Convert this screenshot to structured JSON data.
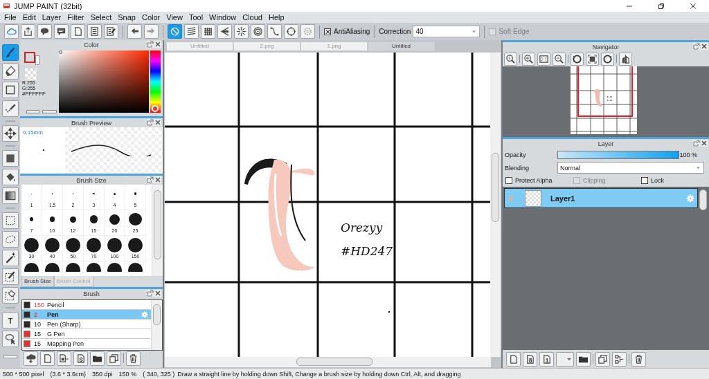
{
  "window": {
    "title": "JUMP PAINT (32bit)"
  },
  "menu": [
    "File",
    "Edit",
    "Layer",
    "Filter",
    "Select",
    "Snap",
    "Color",
    "View",
    "Tool",
    "Window",
    "Cloud",
    "Help"
  ],
  "toolbar": {
    "file_buttons": [
      {
        "kind": "cloud"
      },
      {
        "kind": "export"
      },
      {
        "kind": "balloon"
      },
      {
        "kind": "chat"
      },
      {
        "kind": "page"
      },
      {
        "kind": "list"
      },
      {
        "kind": "editlist"
      }
    ],
    "history_buttons": [
      {
        "kind": "undo"
      },
      {
        "kind": "redo"
      }
    ],
    "ruler_buttons": [
      {
        "kind": "noruler",
        "selected": true
      },
      {
        "kind": "parallel",
        "selected": false
      },
      {
        "kind": "grid",
        "selected": false
      },
      {
        "kind": "fan",
        "selected": false
      },
      {
        "kind": "burst",
        "selected": false
      },
      {
        "kind": "concentric",
        "selected": false
      },
      {
        "kind": "curve",
        "selected": false
      },
      {
        "kind": "ellipse",
        "selected": false
      },
      {
        "kind": "gear",
        "selected": false
      }
    ],
    "antialiasing": {
      "label": "AntiAliasing",
      "checked": true
    },
    "correction": {
      "label": "Correction",
      "value": "40"
    },
    "soft_edge": {
      "label": "Soft Edge",
      "checked": false,
      "disabled": true
    }
  },
  "tools": [
    {
      "kind": "brush",
      "selected": true
    },
    {
      "kind": "eraser",
      "selected": false
    },
    {
      "kind": "square",
      "selected": false
    },
    {
      "kind": "dotline",
      "selected": false
    },
    {
      "kind": "sep"
    },
    {
      "kind": "move",
      "selected": false
    },
    {
      "kind": "sep"
    },
    {
      "kind": "fill",
      "selected": false
    },
    {
      "kind": "bucket",
      "selected": false
    },
    {
      "kind": "gradient",
      "selected": false
    },
    {
      "kind": "sep"
    },
    {
      "kind": "selrect",
      "selected": false
    },
    {
      "kind": "lasso",
      "selected": false
    },
    {
      "kind": "wand",
      "selected": false
    },
    {
      "kind": "selpen",
      "selected": false
    },
    {
      "kind": "selerase",
      "selected": false
    },
    {
      "kind": "sep"
    },
    {
      "kind": "text",
      "glyph": "T",
      "selected": false
    },
    {
      "kind": "lassoarrow",
      "selected": false
    }
  ],
  "color_panel": {
    "title": "Color",
    "hue": {
      "level": 0.0
    },
    "readouts": [
      "R:255",
      "G:255",
      "#FFFFFF"
    ]
  },
  "brush_preview": {
    "title": "Brush Preview",
    "size": "0.15mm"
  },
  "brush_size": {
    "title": "Brush Size",
    "sizes": [
      "1",
      "1.5",
      "2",
      "3",
      "4",
      "5",
      "7",
      "10",
      "12",
      "15",
      "20",
      "25",
      "30",
      "40",
      "50",
      "70",
      "100",
      "150"
    ],
    "tabs": [
      {
        "label": "Brush Size",
        "selected": true
      },
      {
        "label": "Brush Control",
        "selected": false
      }
    ]
  },
  "brush": {
    "title": "Brush",
    "items": [
      {
        "color": "#2a2a2a",
        "size": "150",
        "name": "Pencil",
        "warning": true,
        "selected": false
      },
      {
        "color": "#2a2a2a",
        "size": "2",
        "name": "Pen",
        "warning": true,
        "selected": true
      },
      {
        "color": "#2a2a2a",
        "size": "10",
        "name": "Pen (Sharp)",
        "warning": false,
        "selected": false
      },
      {
        "color": "#e83030",
        "size": "15",
        "name": "G Pen",
        "warning": false,
        "selected": false
      },
      {
        "color": "#e83030",
        "size": "15",
        "name": "Mapping Pen",
        "warning": false,
        "selected": false
      }
    ],
    "buttons": [
      {
        "kind": "clouddown"
      },
      {
        "kind": "page"
      },
      {
        "kind": "pagedrop"
      },
      {
        "kind": "page",
        "glyph": "S"
      },
      {
        "kind": "folder"
      },
      {
        "kind": "copy"
      },
      {
        "kind": "trash"
      }
    ]
  },
  "canvas": {
    "tabs": [
      {
        "label": "Untitled",
        "selected": false
      },
      {
        "label": "2.png",
        "selected": false
      },
      {
        "label": "1.png",
        "selected": false
      },
      {
        "label": "Untitled",
        "selected": true
      }
    ],
    "handwriting": [
      "Orezyy",
      "#HD247"
    ]
  },
  "navigator": {
    "title": "Navigator",
    "buttons": [
      {
        "kind": "zoom1"
      },
      {
        "kind": "zoomin"
      },
      {
        "kind": "fit"
      },
      {
        "kind": "zoomout"
      },
      {
        "kind": "rotl"
      },
      {
        "kind": "center"
      },
      {
        "kind": "rotr"
      },
      {
        "kind": "flip"
      }
    ]
  },
  "layer_panel": {
    "title": "Layer",
    "opacity": {
      "label": "Opacity",
      "level": 1.0,
      "reading": "100 %"
    },
    "blending": {
      "label": "Blending",
      "value": "Normal"
    },
    "options": [
      {
        "label": "Protect Alpha",
        "checked": false,
        "disabled": false
      },
      {
        "label": "Clipping",
        "checked": false,
        "disabled": true
      },
      {
        "label": "Lock",
        "checked": false,
        "disabled": false
      }
    ],
    "layers": [
      {
        "name": "Layer1",
        "selected": true
      }
    ],
    "buttons": [
      {
        "kind": "page"
      },
      {
        "kind": "page",
        "glyph": "8"
      },
      {
        "kind": "page",
        "glyph": "1"
      },
      {
        "kind": "dropblank"
      },
      {
        "kind": "folder"
      },
      {
        "kind": "copy"
      },
      {
        "kind": "merge"
      },
      {
        "kind": "trash"
      }
    ]
  },
  "status_bar": [
    "500 * 500 pixel",
    "(3.6 * 3.6cm)",
    "350 dpi",
    "150 %",
    "( 340, 325 )",
    "Draw a straight line by holding down Shift, Change a brush size by holding down Ctrl, Alt, and dragging"
  ]
}
